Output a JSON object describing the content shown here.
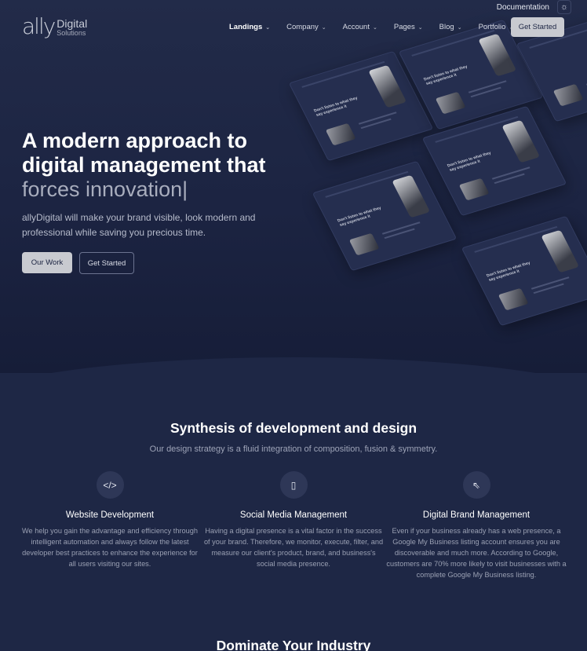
{
  "topbar": {
    "documentation": "Documentation",
    "theme_icon": "sun-icon",
    "theme_glyph": "☼"
  },
  "brand": {
    "mark": "ally",
    "name_top": "Digital",
    "name_bottom": "Solutions"
  },
  "nav": {
    "items": [
      {
        "label": "Landings"
      },
      {
        "label": "Company"
      },
      {
        "label": "Account"
      },
      {
        "label": "Pages"
      },
      {
        "label": "Blog"
      },
      {
        "label": "Portfolio"
      }
    ],
    "cta": "Get Started"
  },
  "hero": {
    "headline_1": "A modern approach to",
    "headline_2": "digital management that",
    "headline_rotating": "forces innovation",
    "cursor": "|",
    "subtext": "allyDigital will make your brand visible, look modern and professional while saving you precious time.",
    "btn_primary": "Our Work",
    "btn_secondary": "Get Started",
    "mock_caption": "Don't listen to what they say experience it"
  },
  "synthesis": {
    "title": "Synthesis of development and design",
    "subtitle": "Our design strategy is a fluid integration of composition, fusion & symmetry.",
    "features": [
      {
        "icon": "code-icon",
        "glyph": "</>",
        "title": "Website Development",
        "desc": "We help you gain the advantage and efficiency through intelligent automation and always follow the latest developer best practices to enhance the experience for all users visiting our sites."
      },
      {
        "icon": "phone-icon",
        "glyph": "▯",
        "title": "Social Media Management",
        "desc": "Having a digital presence is a vital factor in the success of your brand. Therefore, we monitor, execute, filter, and measure our client's product, brand, and business's social media presence."
      },
      {
        "icon": "pointer-click-icon",
        "glyph": "⇖",
        "title": "Digital Brand Management",
        "desc": "Even if your business already has a web presence, a Google My Business listing account ensures you are discoverable and much more. According to Google, customers are 70% more likely to visit businesses with a complete Google My Business listing."
      }
    ]
  },
  "next_section": {
    "title": "Dominate Your Industry"
  }
}
